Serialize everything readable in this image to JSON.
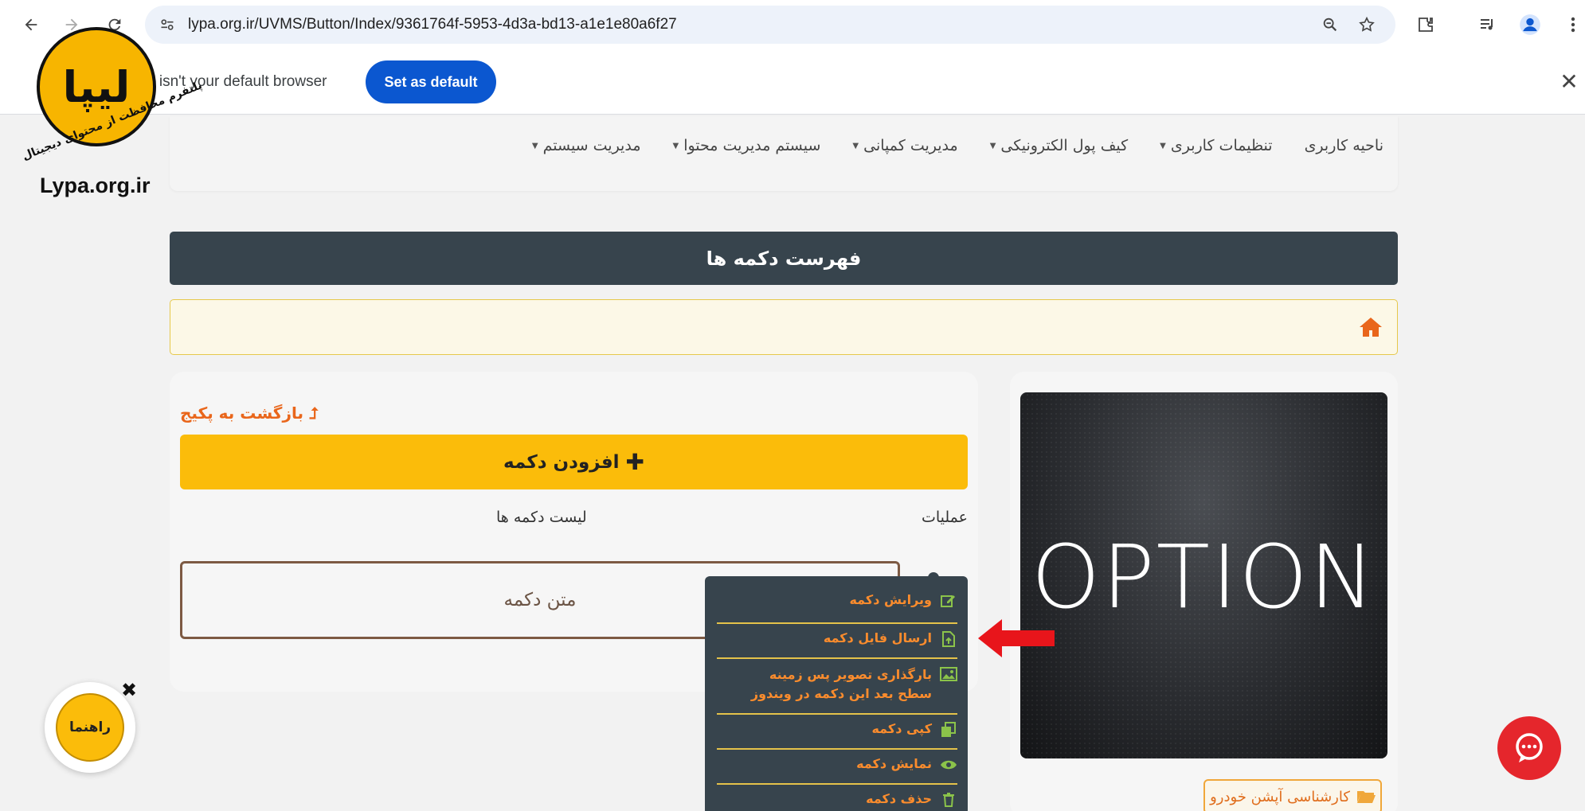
{
  "browser": {
    "url": "lypa.org.ir/UVMS/Button/Index/9361764f-5953-4d3a-bd13-a1e1e80a6f27",
    "infobar_text": "e isn't your default browser",
    "set_default_label": "Set as default",
    "close_label": "✕"
  },
  "logo": {
    "domain": "Lypa.org.ir",
    "ring_text": "پلتفرم محافظت از محتوای دیجیتال",
    "monogram": "لیپا"
  },
  "site_nav": {
    "items": [
      {
        "label": "ناحیه کاربری",
        "dropdown": false
      },
      {
        "label": "تنظیمات کاربری",
        "dropdown": true
      },
      {
        "label": "کیف پول الکترونیکی",
        "dropdown": true
      },
      {
        "label": "مدیریت کمپانی",
        "dropdown": true
      },
      {
        "label": "سیستم مدیریت محتوا",
        "dropdown": true
      },
      {
        "label": "مدیریت سیستم",
        "dropdown": true
      }
    ]
  },
  "page": {
    "title": "فهرست دکمه ها"
  },
  "product": {
    "image_text": "OPTION",
    "category": "کارشناسی آپشن خودرو"
  },
  "buttons_panel": {
    "back_label": "بازگشت به پکیج",
    "add_label": "افزودن دکمه",
    "col_operations": "عملیات",
    "col_list": "لیست دکمه ها",
    "button_text": "متن دکمه"
  },
  "dropdown_menu": {
    "items": [
      {
        "label": "ویرایش دکمه",
        "icon": "edit-icon"
      },
      {
        "label": "ارسال فایل دکمه",
        "icon": "file-upload-icon"
      },
      {
        "label": "بارگذاری تصویر پس زمینه",
        "label2": "سطح بعد این دکمه در ویندوز",
        "icon": "image-icon"
      },
      {
        "label": "کپی دکمه",
        "icon": "copy-icon"
      },
      {
        "label": "نمایش دکمه",
        "icon": "eye-icon"
      },
      {
        "label": "حذف دکمه",
        "icon": "trash-icon"
      }
    ]
  },
  "help_widget": {
    "label": "راهنما",
    "close": "✖"
  },
  "colors": {
    "header_dark": "#37444d",
    "accent_yellow": "#fbbc0a",
    "accent_orange": "#fb8c2d",
    "chrome_blue": "#0b57d0",
    "chat_red": "#e5262c"
  }
}
